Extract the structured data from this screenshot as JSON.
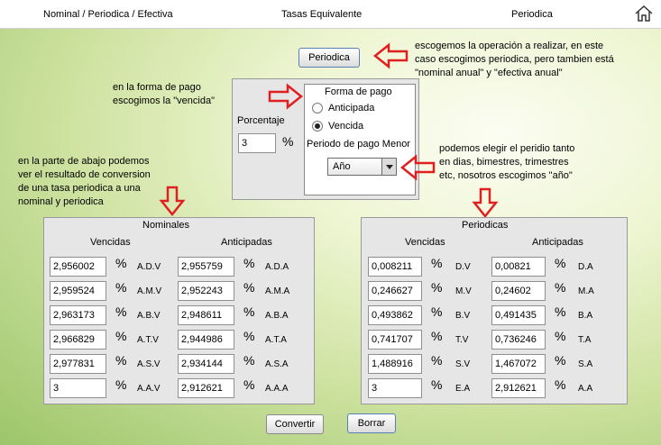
{
  "topbar": {
    "left": "Nominal / Periodica / Efectiva",
    "center": "Tasas Equivalente",
    "right": "Periodica"
  },
  "buttons": {
    "periodica": "Periodica",
    "convertir": "Convertir",
    "borrar": "Borrar"
  },
  "notes": {
    "top_right": [
      "escogemos la operación a realizar, en este",
      "caso escogimos periodica, pero tambien está",
      "\"nominal anual\" y \"efectiva anual\""
    ],
    "forma_pago": [
      "en la forma de pago",
      "escogimos la \"vencida\""
    ],
    "left_bottom": [
      "en la parte de abajo podemos",
      "ver el resultado de conversion",
      "de una tasa periodica a una",
      "nominal y periodica"
    ],
    "right_mid": [
      "podemos elegir el peridio tanto",
      "en dias, bimestres, trimestres",
      "etc, nosotros escogimos \"año\""
    ]
  },
  "form": {
    "porcentaje_label": "Porcentaje",
    "porcentaje_value": "3",
    "pct_symbol": "%",
    "forma_pago_title": "Forma de pago",
    "anticipada": "Anticipada",
    "vencida": "Vencida",
    "periodo_label": "Periodo de pago Menor",
    "periodo_value": "Año"
  },
  "nominales": {
    "title": "Nominales",
    "col1": "Vencidas",
    "col2": "Anticipadas",
    "rows": [
      {
        "v": "2,956002",
        "vc": "A.D.V",
        "a": "2,955759",
        "ac": "A.D.A"
      },
      {
        "v": "2,959524",
        "vc": "A.M.V",
        "a": "2,952243",
        "ac": "A.M.A"
      },
      {
        "v": "2,963173",
        "vc": "A.B.V",
        "a": "2,948611",
        "ac": "A.B.A"
      },
      {
        "v": "2,966829",
        "vc": "A.T.V",
        "a": "2,944986",
        "ac": "A.T.A"
      },
      {
        "v": "2,977831",
        "vc": "A.S.V",
        "a": "2,934144",
        "ac": "A.S.A"
      },
      {
        "v": "3",
        "vc": "A.A.V",
        "a": "2,912621",
        "ac": "A.A.A"
      }
    ]
  },
  "periodicas": {
    "title": "Periodicas",
    "col1": "Vencidas",
    "col2": "Anticipadas",
    "rows": [
      {
        "v": "0,008211",
        "vc": "D.V",
        "a": "0,00821",
        "ac": "D.A"
      },
      {
        "v": "0,246627",
        "vc": "M.V",
        "a": "0,24602",
        "ac": "M.A"
      },
      {
        "v": "0,493862",
        "vc": "B.V",
        "a": "0,491435",
        "ac": "B.A"
      },
      {
        "v": "0,741707",
        "vc": "T.V",
        "a": "0,736246",
        "ac": "T.A"
      },
      {
        "v": "1,488916",
        "vc": "S.V",
        "a": "1,467072",
        "ac": "S.A"
      },
      {
        "v": "3",
        "vc": "E.A",
        "a": "2,912621",
        "ac": "A.A"
      }
    ]
  },
  "colors": {
    "arrow": "#e02020"
  }
}
